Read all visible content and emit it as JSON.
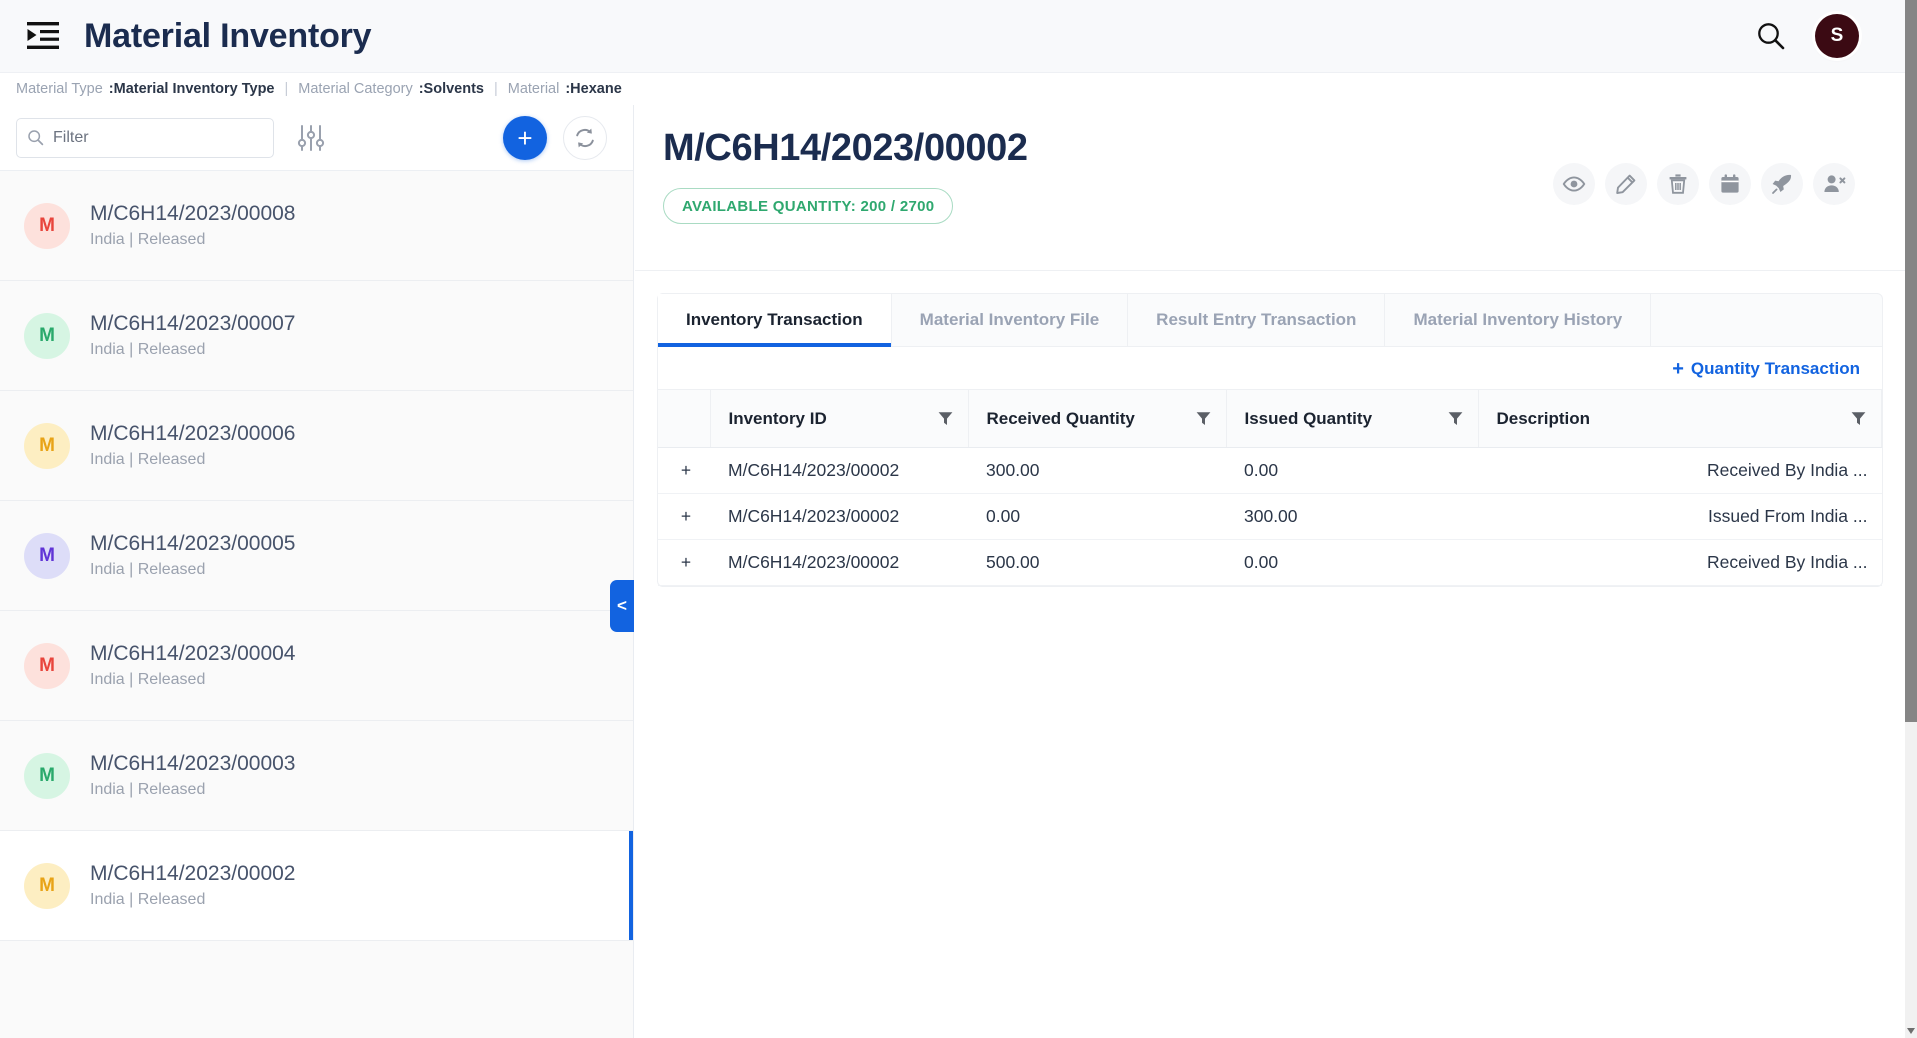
{
  "header": {
    "title": "Material Inventory",
    "menu_icon": "indent-menu-icon",
    "search_icon": "search-icon",
    "avatar_initial": "S",
    "avatar_color": "#3b0a13"
  },
  "breadcrumb": {
    "items": [
      {
        "label": "Material Type",
        "value": ":Material Inventory Type"
      },
      {
        "label": "Material Category",
        "value": ":Solvents"
      },
      {
        "label": "Material",
        "value": ":Hexane"
      }
    ],
    "separator": "|"
  },
  "sidebar": {
    "filter": {
      "placeholder": "Filter",
      "value": ""
    },
    "sliders_icon": "sliders-icon",
    "add_label": "+",
    "refresh_icon": "refresh-icon",
    "collapse_label": "<",
    "items": [
      {
        "initial": "M",
        "title": "M/C6H14/2023/00008",
        "subtitle": "India | Released",
        "bg": "#fde1dc",
        "fg": "#e8453c",
        "selected": false
      },
      {
        "initial": "M",
        "title": "M/C6H14/2023/00007",
        "subtitle": "India | Released",
        "bg": "#d6f5e3",
        "fg": "#2aa96b",
        "selected": false
      },
      {
        "initial": "M",
        "title": "M/C6H14/2023/00006",
        "subtitle": "India | Released",
        "bg": "#fdeec2",
        "fg": "#e8a317",
        "selected": false
      },
      {
        "initial": "M",
        "title": "M/C6H14/2023/00005",
        "subtitle": "India | Released",
        "bg": "#ddddf8",
        "fg": "#6034d6",
        "selected": false
      },
      {
        "initial": "M",
        "title": "M/C6H14/2023/00004",
        "subtitle": "India | Released",
        "bg": "#fde1dc",
        "fg": "#e8453c",
        "selected": false
      },
      {
        "initial": "M",
        "title": "M/C6H14/2023/00003",
        "subtitle": "India | Released",
        "bg": "#d6f5e3",
        "fg": "#2aa96b",
        "selected": false
      },
      {
        "initial": "M",
        "title": "M/C6H14/2023/00002",
        "subtitle": "India | Released",
        "bg": "#fdeec2",
        "fg": "#e8a317",
        "selected": true
      }
    ]
  },
  "detail": {
    "title": "M/C6H14/2023/00002",
    "available_quantity_badge": "AVAILABLE QUANTITY: 200 / 2700",
    "badge_color": "#2fa86f",
    "actions": [
      {
        "name": "view-button",
        "icon": "eye-icon"
      },
      {
        "name": "edit-button",
        "icon": "pencil-icon"
      },
      {
        "name": "delete-button",
        "icon": "trash-icon"
      },
      {
        "name": "calendar-button",
        "icon": "calendar-icon"
      },
      {
        "name": "release-button",
        "icon": "rocket-icon"
      },
      {
        "name": "remove-user-button",
        "icon": "person-remove-icon"
      }
    ],
    "tabs": [
      {
        "label": "Inventory Transaction",
        "active": true
      },
      {
        "label": "Material Inventory File",
        "active": false
      },
      {
        "label": "Result Entry Transaction",
        "active": false
      },
      {
        "label": "Material Inventory History",
        "active": false
      }
    ],
    "quantity_transaction_link": "Quantity Transaction",
    "accent_color": "#1263e0",
    "table": {
      "columns": [
        "Inventory ID",
        "Received Quantity",
        "Issued Quantity",
        "Description"
      ],
      "filter_icon": "funnel-icon",
      "expand_glyph": "+",
      "rows": [
        {
          "id": "M/C6H14/2023/00002",
          "received": "300.00",
          "issued": "0.00",
          "description": "Received By India ..."
        },
        {
          "id": "M/C6H14/2023/00002",
          "received": "0.00",
          "issued": "300.00",
          "description": "Issued From India ..."
        },
        {
          "id": "M/C6H14/2023/00002",
          "received": "500.00",
          "issued": "0.00",
          "description": "Received By India ..."
        }
      ]
    }
  }
}
